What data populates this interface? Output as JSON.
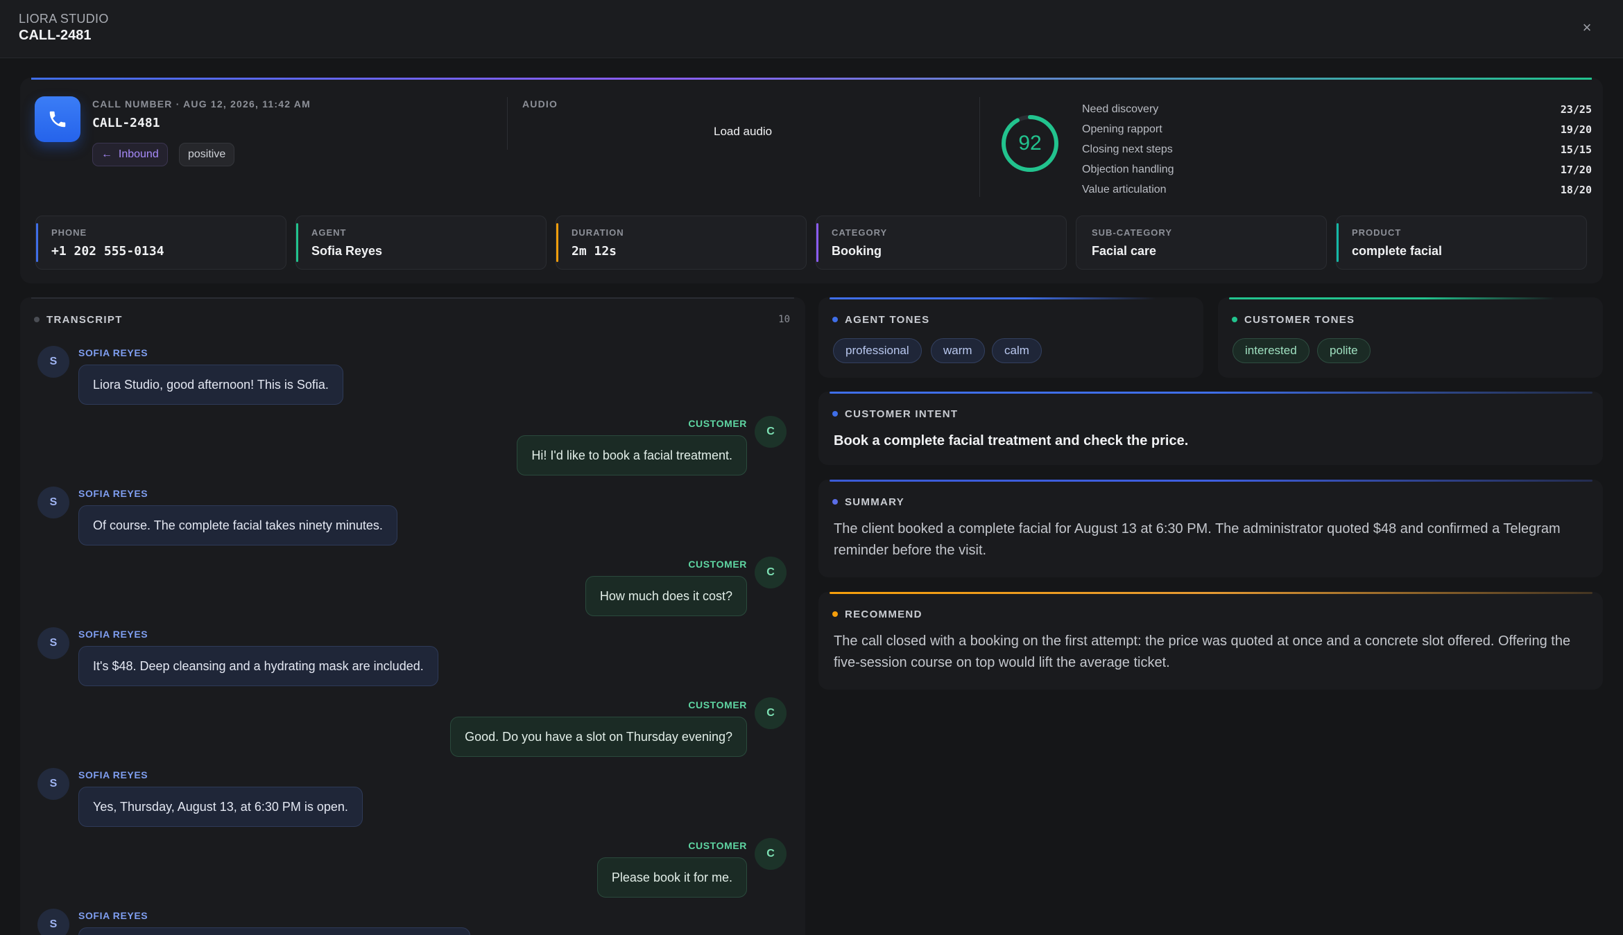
{
  "header": {
    "brand": "LIORA STUDIO",
    "title": "CALL-2481",
    "close_label": "×"
  },
  "call": {
    "meta_label": "CALL NUMBER · AUG 12, 2026, 11:42 AM",
    "number": "CALL-2481",
    "direction": "Inbound",
    "sentiment": "positive",
    "audio_label": "AUDIO",
    "load_audio": "Load audio"
  },
  "score": {
    "total": "92",
    "total_fraction": 0.92,
    "accent_color": "#22c38e",
    "items": [
      {
        "label": "Need discovery",
        "value": "23/25"
      },
      {
        "label": "Opening rapport",
        "value": "19/20"
      },
      {
        "label": "Closing next steps",
        "value": "15/15"
      },
      {
        "label": "Objection handling",
        "value": "17/20"
      },
      {
        "label": "Value articulation",
        "value": "18/20"
      }
    ]
  },
  "info": [
    {
      "label": "PHONE",
      "value": "+1 202 555-0134",
      "color": "#3f6ee8"
    },
    {
      "label": "AGENT",
      "value": "Sofia Reyes",
      "color": "#22c38e"
    },
    {
      "label": "DURATION",
      "value": "2m 12s",
      "color": "#f59e0b"
    },
    {
      "label": "CATEGORY",
      "value": "Booking",
      "color": "#8b5cf6"
    },
    {
      "label": "SUB-CATEGORY",
      "value": "Facial care",
      "color": "#1e1f23"
    },
    {
      "label": "PRODUCT",
      "value": "complete facial",
      "color": "#14b8a6"
    }
  ],
  "transcript": {
    "title": "TRANSCRIPT",
    "count": "10",
    "messages": [
      {
        "speaker": "agent",
        "name": "SOFIA REYES",
        "initial": "S",
        "text": "Liora Studio, good afternoon! This is Sofia."
      },
      {
        "speaker": "customer",
        "name": "CUSTOMER",
        "initial": "C",
        "text": "Hi! I'd like to book a facial treatment."
      },
      {
        "speaker": "agent",
        "name": "SOFIA REYES",
        "initial": "S",
        "text": "Of course. The complete facial takes ninety minutes."
      },
      {
        "speaker": "customer",
        "name": "CUSTOMER",
        "initial": "C",
        "text": "How much does it cost?"
      },
      {
        "speaker": "agent",
        "name": "SOFIA REYES",
        "initial": "S",
        "text": "It's $48. Deep cleansing and a hydrating mask are included."
      },
      {
        "speaker": "customer",
        "name": "CUSTOMER",
        "initial": "C",
        "text": "Good. Do you have a slot on Thursday evening?"
      },
      {
        "speaker": "agent",
        "name": "SOFIA REYES",
        "initial": "S",
        "text": "Yes, Thursday, August 13, at 6:30 PM is open."
      },
      {
        "speaker": "customer",
        "name": "CUSTOMER",
        "initial": "C",
        "text": "Please book it for me."
      },
      {
        "speaker": "agent",
        "name": "SOFIA REYES",
        "initial": "S",
        "text": ""
      }
    ]
  },
  "agent_tones": {
    "title": "AGENT TONES",
    "tags": [
      "professional",
      "warm",
      "calm"
    ]
  },
  "customer_tones": {
    "title": "CUSTOMER TONES",
    "tags": [
      "interested",
      "polite"
    ]
  },
  "intent": {
    "title": "CUSTOMER INTENT",
    "text": "Book a complete facial treatment and check the price."
  },
  "summary": {
    "title": "SUMMARY",
    "text": "The client booked a complete facial for August 13 at 6:30 PM. The administrator quoted $48 and confirmed a Telegram reminder before the visit."
  },
  "recommend": {
    "title": "RECOMMEND",
    "text": "The call closed with a booking on the first attempt: the price was quoted at once and a concrete slot offered. Offering the five-session course on top would lift the average ticket."
  }
}
